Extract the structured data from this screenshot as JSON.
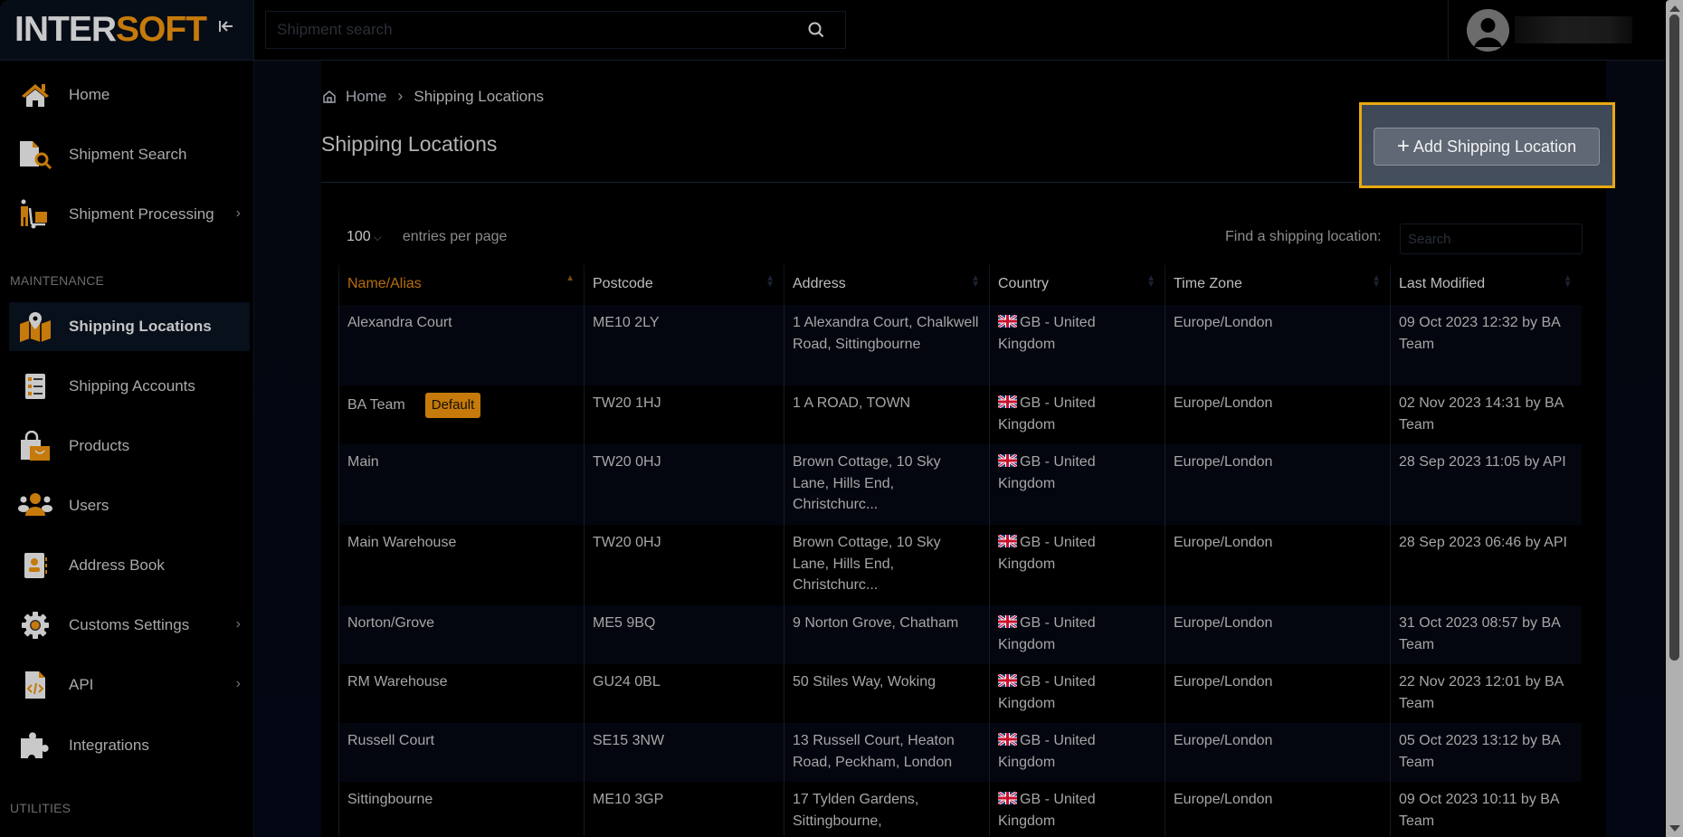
{
  "app": {
    "logo_part1": "INTER",
    "logo_part2": "SOFT",
    "brand_color": "#c57a0b"
  },
  "header": {
    "search_placeholder": "Shipment search",
    "search_value": ""
  },
  "sidebar": {
    "items": [
      {
        "label": "Home",
        "icon": "home-icon",
        "has_chevron": false
      },
      {
        "label": "Shipment Search",
        "icon": "document-search-icon",
        "has_chevron": false
      },
      {
        "label": "Shipment Processing",
        "icon": "hand-truck-icon",
        "has_chevron": true
      }
    ],
    "section_maintenance": "MAINTENANCE",
    "maintenance_items": [
      {
        "label": "Shipping Locations",
        "icon": "map-pin-icon",
        "active": true
      },
      {
        "label": "Shipping Accounts",
        "icon": "list-icon"
      },
      {
        "label": "Products",
        "icon": "shopping-bag-icon"
      },
      {
        "label": "Users",
        "icon": "users-icon"
      },
      {
        "label": "Address Book",
        "icon": "address-book-icon"
      },
      {
        "label": "Customs Settings",
        "icon": "gear-icon",
        "has_chevron": true
      },
      {
        "label": "API",
        "icon": "code-file-icon",
        "has_chevron": true
      },
      {
        "label": "Integrations",
        "icon": "puzzle-icon"
      }
    ],
    "section_utilities": "UTILITIES"
  },
  "breadcrumb": {
    "home": "Home",
    "current": "Shipping Locations"
  },
  "page": {
    "title": "Shipping Locations",
    "add_button": "Add Shipping Location",
    "add_button_icon": "plus-icon"
  },
  "table_controls": {
    "entries_value": "100",
    "entries_label": "entries per page",
    "find_label": "Find a shipping location:",
    "find_placeholder": "Search",
    "find_value": ""
  },
  "table": {
    "columns": [
      "Name/Alias",
      "Postcode",
      "Address",
      "Country",
      "Time Zone",
      "Last Modified"
    ],
    "sorted_column": "Name/Alias",
    "sort_direction": "ascending",
    "rows": [
      {
        "name": "Alexandra Court",
        "badge": "",
        "postcode": "ME10 2LY",
        "address": "1 Alexandra Court, Chalkwell Road, Sittingbourne",
        "country": "GB - United Kingdom",
        "timezone": "Europe/London",
        "modified": "09 Oct 2023 12:32 by BA Team"
      },
      {
        "name": "BA Team",
        "badge": "Default",
        "postcode": "TW20 1HJ",
        "address": "1 A ROAD, TOWN",
        "country": "GB - United Kingdom",
        "timezone": "Europe/London",
        "modified": "02 Nov 2023 14:31 by BA Team"
      },
      {
        "name": "Main",
        "badge": "",
        "postcode": "TW20 0HJ",
        "address": "Brown Cottage, 10 Sky Lane, Hills End, Christchurc...",
        "country": "GB - United Kingdom",
        "timezone": "Europe/London",
        "modified": "28 Sep 2023 11:05 by API"
      },
      {
        "name": "Main Warehouse",
        "badge": "",
        "postcode": "TW20 0HJ",
        "address": "Brown Cottage, 10 Sky Lane, Hills End, Christchurc...",
        "country": "GB - United Kingdom",
        "timezone": "Europe/London",
        "modified": "28 Sep 2023 06:46 by API"
      },
      {
        "name": "Norton/Grove",
        "badge": "",
        "postcode": "ME5 9BQ",
        "address": "9 Norton Grove, Chatham",
        "country": "GB - United Kingdom",
        "timezone": "Europe/London",
        "modified": "31 Oct 2023 08:57 by BA Team"
      },
      {
        "name": "RM Warehouse",
        "badge": "",
        "postcode": "GU24 0BL",
        "address": "50 Stiles Way, Woking",
        "country": "GB - United Kingdom",
        "timezone": "Europe/London",
        "modified": "22 Nov 2023 12:01 by BA Team"
      },
      {
        "name": "Russell Court",
        "badge": "",
        "postcode": "SE15 3NW",
        "address": "13 Russell Court, Heaton Road, Peckham, London",
        "country": "GB - United Kingdom",
        "timezone": "Europe/London",
        "modified": "05 Oct 2023 13:12 by BA Team"
      },
      {
        "name": "Sittingbourne",
        "badge": "",
        "postcode": "ME10 3GP",
        "address": "17 Tylden Gardens, Sittingbourne,",
        "country": "GB - United Kingdom",
        "timezone": "Europe/London",
        "modified": "09 Oct 2023 10:11 by BA Team"
      }
    ]
  },
  "colors": {
    "accent": "#c57a0b",
    "highlight_border": "#e9a90f",
    "button_bg": "#5f6874"
  }
}
